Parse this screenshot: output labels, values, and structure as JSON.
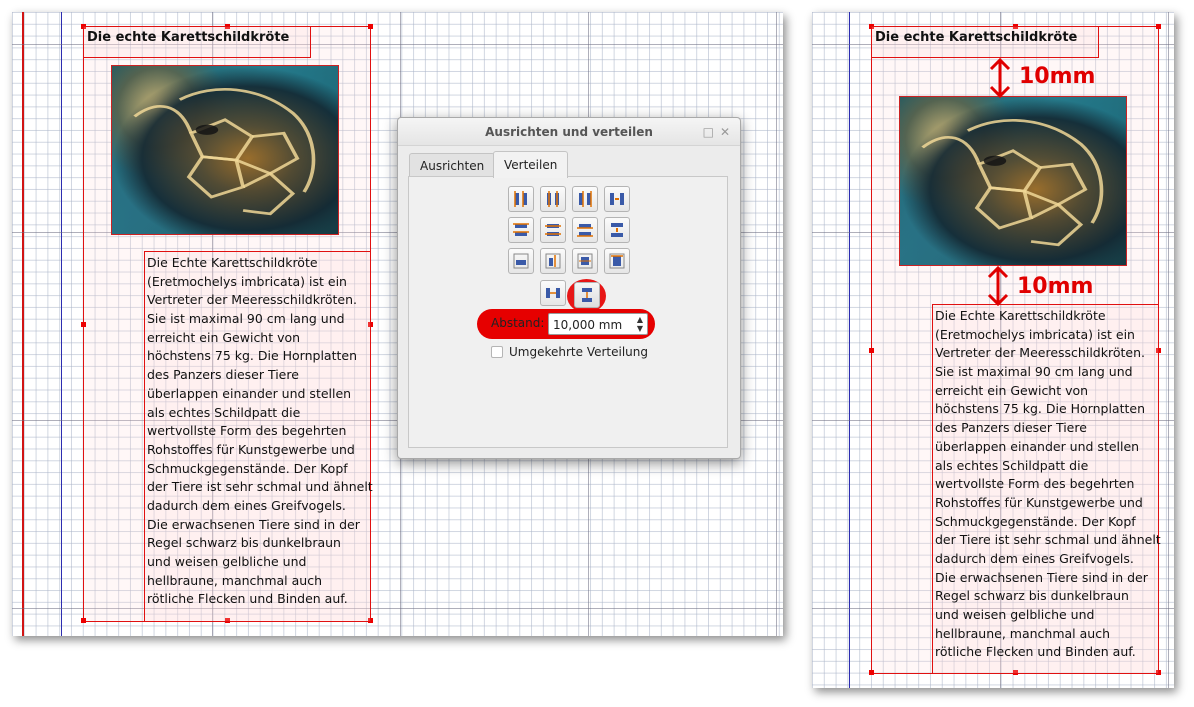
{
  "document": {
    "heading": "Die echte Karettschildkröte",
    "body_lines": [
      "Die Echte Karettschildkröte",
      "(Eretmochelys imbricata) ist ein",
      "Vertreter der Meeresschildkröten.",
      "Sie ist maximal 90 cm lang und",
      "erreicht ein Gewicht von",
      "höchstens 75 kg. Die Hornplatten",
      "des Panzers dieser Tiere",
      "überlappen einander und stellen",
      "als echtes Schildpatt die",
      "wertvollste Form des begehrten",
      "Rohstoffes für Kunstgewerbe und",
      "Schmuckgegenstände. Der Kopf",
      "der Tiere ist sehr schmal und ähnelt",
      "dadurch dem eines Greifvogels.",
      "Die erwachsenen Tiere sind in der",
      "Regel schwarz bis dunkelbraun",
      "und weisen gelbliche und",
      "hellbraune, manchmal auch",
      "rötliche Flecken und Binden auf."
    ]
  },
  "dialog": {
    "title": "Ausrichten und verteilen",
    "maximize_glyph": "□",
    "close_glyph": "✕",
    "tabs": [
      {
        "label": "Ausrichten",
        "active": false
      },
      {
        "label": "Verteilen",
        "active": true
      }
    ],
    "spacing_label": "Abstand:",
    "spacing_value": "10,000 mm",
    "reverse_label": "Umgekehrte Verteilung",
    "reverse_checked": false
  },
  "annotations": {
    "top_gap": "10mm",
    "bottom_gap": "10mm"
  },
  "colors": {
    "highlight_red": "#e60000",
    "frame_red": "#e01010",
    "icon_orange": "#e07000",
    "icon_blue": "#3a5aa8"
  },
  "icons": {
    "distribute_buttons": [
      "distribute-left-icon",
      "distribute-hcenter-icon",
      "distribute-right-icon",
      "distribute-hgap-icon",
      "distribute-top-icon",
      "distribute-vcenter-icon",
      "distribute-bottom-icon",
      "distribute-vgap-icon",
      "distribute-page-width-icon",
      "distribute-page-margin-icon",
      "distribute-page-height-icon",
      "distribute-page-vmargin-icon",
      "distribute-hspace-icon",
      "distribute-vspace-icon"
    ]
  }
}
